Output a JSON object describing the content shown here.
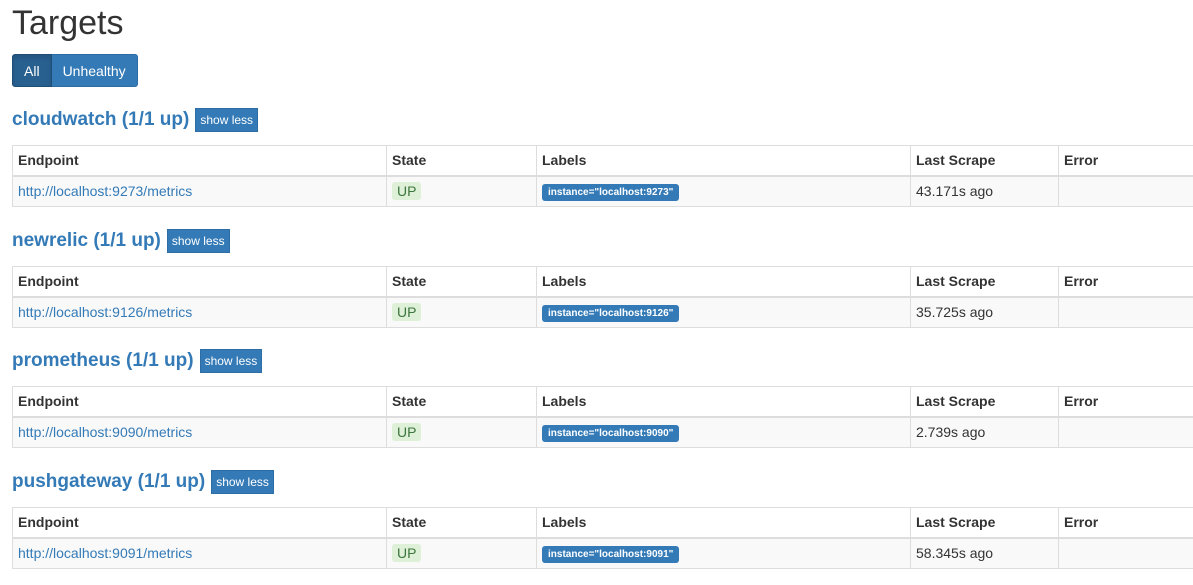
{
  "page": {
    "title": "Targets"
  },
  "filters": {
    "all_label": "All",
    "unhealthy_label": "Unhealthy"
  },
  "table_headers": {
    "endpoint": "Endpoint",
    "state": "State",
    "labels": "Labels",
    "last_scrape": "Last Scrape",
    "error": "Error"
  },
  "jobs": [
    {
      "title": "cloudwatch (1/1 up)",
      "toggle_label": "show less",
      "targets": [
        {
          "endpoint": "http://localhost:9273/metrics",
          "state": "UP",
          "label": "instance=\"localhost:9273\"",
          "last_scrape": "43.171s ago",
          "error": ""
        }
      ]
    },
    {
      "title": "newrelic (1/1 up)",
      "toggle_label": "show less",
      "targets": [
        {
          "endpoint": "http://localhost:9126/metrics",
          "state": "UP",
          "label": "instance=\"localhost:9126\"",
          "last_scrape": "35.725s ago",
          "error": ""
        }
      ]
    },
    {
      "title": "prometheus (1/1 up)",
      "toggle_label": "show less",
      "targets": [
        {
          "endpoint": "http://localhost:9090/metrics",
          "state": "UP",
          "label": "instance=\"localhost:9090\"",
          "last_scrape": "2.739s ago",
          "error": ""
        }
      ]
    },
    {
      "title": "pushgateway (1/1 up)",
      "toggle_label": "show less",
      "targets": [
        {
          "endpoint": "http://localhost:9091/metrics",
          "state": "UP",
          "label": "instance=\"localhost:9091\"",
          "last_scrape": "58.345s ago",
          "error": ""
        }
      ]
    }
  ],
  "colors": {
    "primary": "#337ab7",
    "primary_active": "#286090",
    "state_up_bg": "#dff0d8",
    "state_up_text": "#3c763d"
  }
}
